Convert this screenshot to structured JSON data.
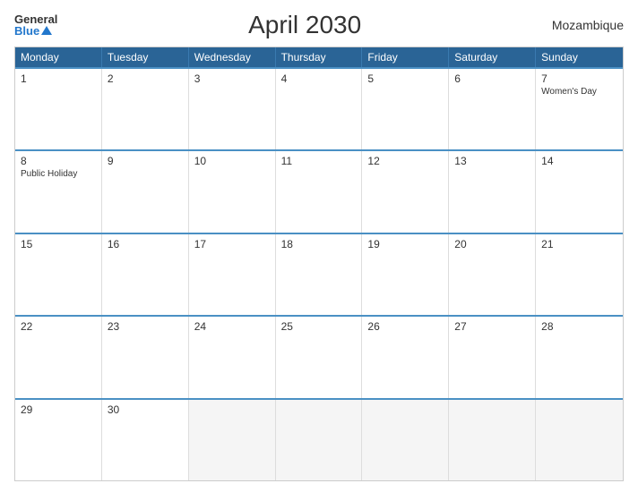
{
  "header": {
    "logo_general": "General",
    "logo_blue": "Blue",
    "title": "April 2030",
    "country": "Mozambique"
  },
  "days_of_week": [
    "Monday",
    "Tuesday",
    "Wednesday",
    "Thursday",
    "Friday",
    "Saturday",
    "Sunday"
  ],
  "weeks": [
    [
      {
        "day": "1",
        "holiday": ""
      },
      {
        "day": "2",
        "holiday": ""
      },
      {
        "day": "3",
        "holiday": ""
      },
      {
        "day": "4",
        "holiday": ""
      },
      {
        "day": "5",
        "holiday": ""
      },
      {
        "day": "6",
        "holiday": ""
      },
      {
        "day": "7",
        "holiday": "Women's Day"
      }
    ],
    [
      {
        "day": "8",
        "holiday": "Public Holiday"
      },
      {
        "day": "9",
        "holiday": ""
      },
      {
        "day": "10",
        "holiday": ""
      },
      {
        "day": "11",
        "holiday": ""
      },
      {
        "day": "12",
        "holiday": ""
      },
      {
        "day": "13",
        "holiday": ""
      },
      {
        "day": "14",
        "holiday": ""
      }
    ],
    [
      {
        "day": "15",
        "holiday": ""
      },
      {
        "day": "16",
        "holiday": ""
      },
      {
        "day": "17",
        "holiday": ""
      },
      {
        "day": "18",
        "holiday": ""
      },
      {
        "day": "19",
        "holiday": ""
      },
      {
        "day": "20",
        "holiday": ""
      },
      {
        "day": "21",
        "holiday": ""
      }
    ],
    [
      {
        "day": "22",
        "holiday": ""
      },
      {
        "day": "23",
        "holiday": ""
      },
      {
        "day": "24",
        "holiday": ""
      },
      {
        "day": "25",
        "holiday": ""
      },
      {
        "day": "26",
        "holiday": ""
      },
      {
        "day": "27",
        "holiday": ""
      },
      {
        "day": "28",
        "holiday": ""
      }
    ],
    [
      {
        "day": "29",
        "holiday": ""
      },
      {
        "day": "30",
        "holiday": ""
      },
      {
        "day": "",
        "holiday": ""
      },
      {
        "day": "",
        "holiday": ""
      },
      {
        "day": "",
        "holiday": ""
      },
      {
        "day": "",
        "holiday": ""
      },
      {
        "day": "",
        "holiday": ""
      }
    ]
  ]
}
